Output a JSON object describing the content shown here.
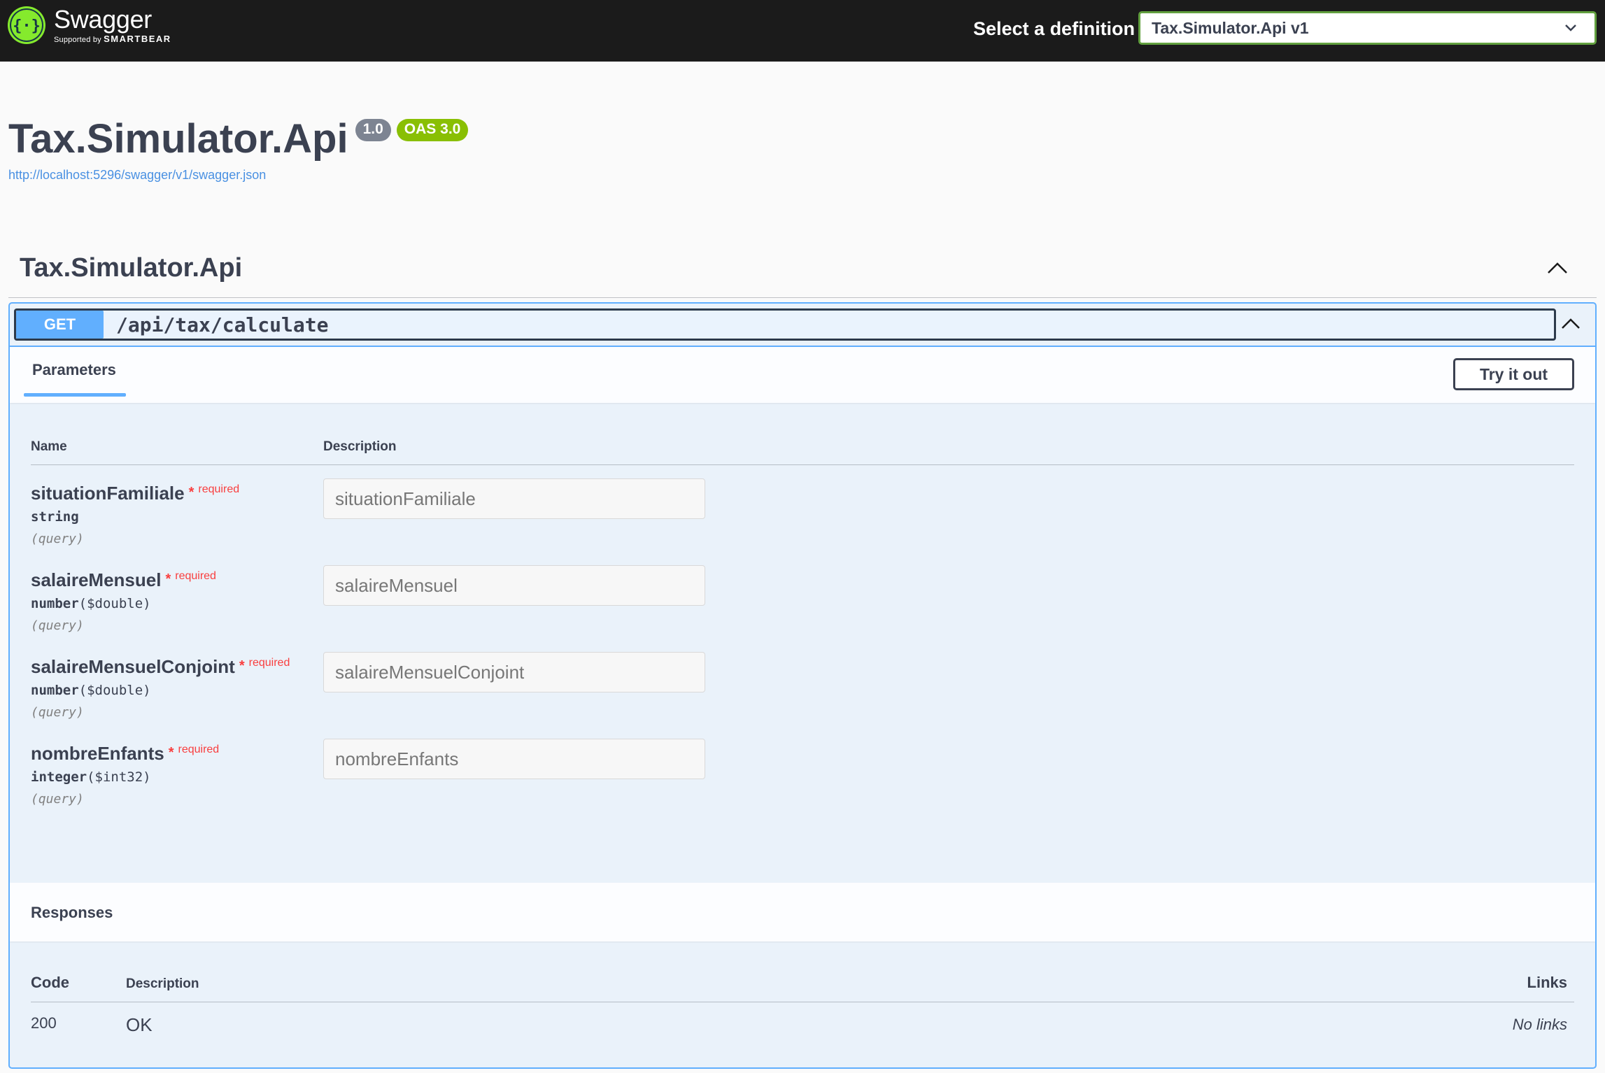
{
  "topbar": {
    "logo_title": "Swagger",
    "logo_sub_prefix": "Supported by",
    "logo_sub_brand": "SMARTBEAR",
    "definition_label": "Select a definition",
    "definition_value": "Tax.Simulator.Api v1",
    "accent": "#62a03f"
  },
  "info": {
    "title": "Tax.Simulator.Api",
    "version": "1.0",
    "oas": "OAS 3.0",
    "url": "http://localhost:5296/swagger/v1/swagger.json"
  },
  "tag": {
    "name": "Tax.Simulator.Api"
  },
  "operation": {
    "method": "GET",
    "path": "/api/tax/calculate",
    "method_color": "#61affe",
    "parameters_tab": "Parameters",
    "try_it_out": "Try it out",
    "columns": {
      "name": "Name",
      "description": "Description"
    },
    "parameters": [
      {
        "name": "situationFamiliale",
        "star": "*",
        "required": "required",
        "type": "string",
        "format": "",
        "in": "(query)",
        "placeholder": "situationFamiliale"
      },
      {
        "name": "salaireMensuel",
        "star": "*",
        "required": "required",
        "type": "number",
        "format": "($double)",
        "in": "(query)",
        "placeholder": "salaireMensuel"
      },
      {
        "name": "salaireMensuelConjoint",
        "star": "*",
        "required": "required",
        "type": "number",
        "format": "($double)",
        "in": "(query)",
        "placeholder": "salaireMensuelConjoint"
      },
      {
        "name": "nombreEnfants",
        "star": "*",
        "required": "required",
        "type": "integer",
        "format": "($int32)",
        "in": "(query)",
        "placeholder": "nombreEnfants"
      }
    ],
    "responses": {
      "title": "Responses",
      "columns": {
        "code": "Code",
        "description": "Description",
        "links": "Links"
      },
      "rows": [
        {
          "code": "200",
          "description": "OK",
          "links": "No links"
        }
      ]
    }
  }
}
